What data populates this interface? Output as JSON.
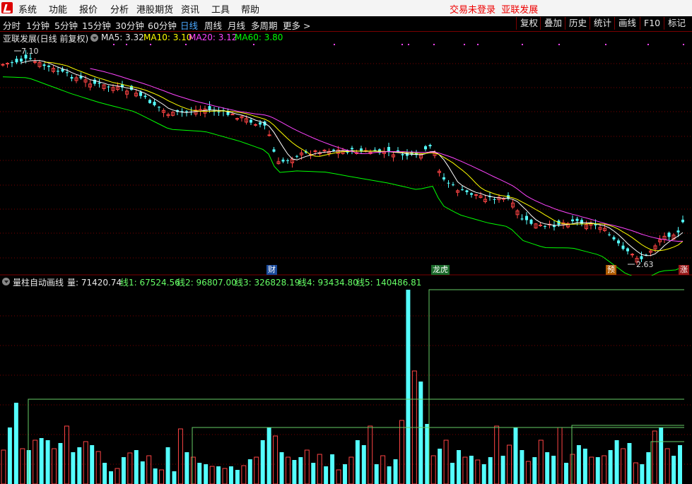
{
  "menubar": {
    "items": [
      "系统",
      "功能",
      "报价",
      "分析",
      "港股期货",
      "资讯",
      "工具",
      "帮助"
    ],
    "status_login": "交易未登录",
    "status_stock": "亚联发展"
  },
  "tabs": {
    "items": [
      "分时",
      "1分钟",
      "5分钟",
      "15分钟",
      "30分钟",
      "60分钟",
      "日线",
      "周线",
      "月线",
      "多周期",
      "更多 >"
    ],
    "active": "日线",
    "right_buttons": [
      "复权",
      "叠加",
      "历史",
      "统计",
      "画线",
      "F10",
      "标记"
    ]
  },
  "main_chart": {
    "title": "亚联发展(日线 前复权)",
    "ma5_label": "MA5: 3.32",
    "ma10_label": "MA10: 3.10",
    "ma20_label": "MA20: 3.12",
    "ma60_label": "MA60: 3.80",
    "high_label": "7.10",
    "low_label": "2.63",
    "events": [
      "财",
      "龙虎",
      "预",
      "涨"
    ]
  },
  "volume_panel": {
    "title": "量柱自动画线",
    "vol_label": "量: 71420.74",
    "line1": "线1: 67524.56",
    "line2": "线2: 96807.00",
    "line3": "线3: 326828.19",
    "line4": "线4: 93434.80",
    "line5": "线5: 140486.81"
  },
  "colors": {
    "up": "#ff4444",
    "down": "#54ffff",
    "ma5": "#ffffff",
    "ma10": "#ffff00",
    "ma20": "#ff44ff",
    "ma60": "#00ff00",
    "grid": "#7a0000"
  },
  "chart_data": {
    "type": "candlestick",
    "price_high": 7.1,
    "price_low": 2.63,
    "ma": {
      "MA5": 3.32,
      "MA10": 3.1,
      "MA20": 3.12,
      "MA60": 3.8
    },
    "volume": 71420.74,
    "volume_lines": [
      67524.56,
      96807.0,
      326828.19,
      93434.8,
      140486.81
    ]
  }
}
